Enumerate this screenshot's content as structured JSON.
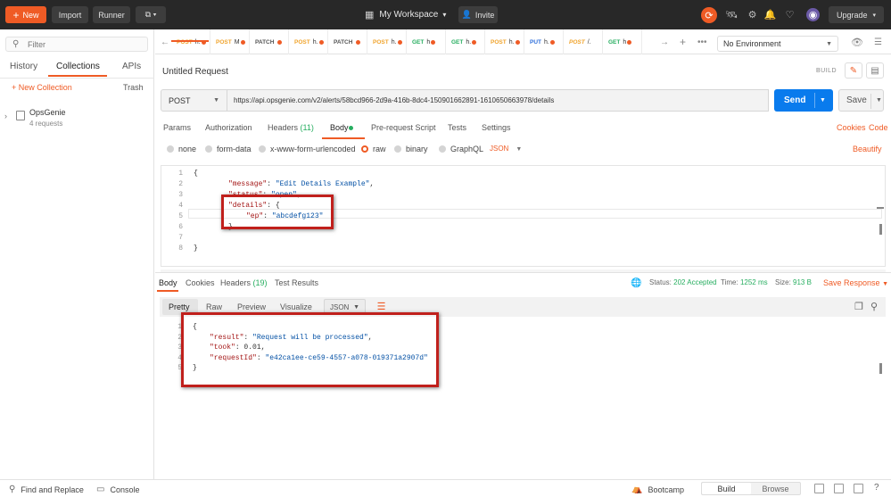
{
  "topbar": {
    "new_label": "New",
    "import_label": "Import",
    "runner_label": "Runner",
    "workspace_label": "My Workspace",
    "invite_label": "Invite",
    "upgrade_label": "Upgrade"
  },
  "sidebar": {
    "search_placeholder": "Filter",
    "tabs": [
      "History",
      "Collections",
      "APIs"
    ],
    "new_collection_label": "+ New Collection",
    "trash_label": "Trash",
    "collection": {
      "name": "OpsGenie",
      "count": "4 requests"
    }
  },
  "tabs": [
    {
      "method": "POST",
      "name": "h."
    },
    {
      "method": "POST",
      "name": "M"
    },
    {
      "method": "PATCH",
      "name": ""
    },
    {
      "method": "POST",
      "name": "h."
    },
    {
      "method": "PATCH",
      "name": ""
    },
    {
      "method": "POST",
      "name": "h."
    },
    {
      "method": "GET",
      "name": "h"
    },
    {
      "method": "GET",
      "name": "h."
    },
    {
      "method": "POST",
      "name": "h."
    },
    {
      "method": "PUT",
      "name": "h."
    },
    {
      "method": "POST",
      "name": "/."
    },
    {
      "method": "GET",
      "name": "h"
    }
  ],
  "environment": "No Environment",
  "request": {
    "title": "Untitled Request",
    "build_label": "BUILD",
    "method": "POST",
    "url": "https://api.opsgenie.com/v2/alerts/58bcd966-2d9a-416b-8dc4-150901662891-1610650663978/details",
    "send_label": "Send",
    "save_label": "Save"
  },
  "request_tabs": {
    "params": "Params",
    "authorization": "Authorization",
    "headers": "Headers",
    "headers_count": "(11)",
    "body": "Body",
    "pre_request": "Pre-request Script",
    "tests": "Tests",
    "settings": "Settings",
    "cookies": "Cookies",
    "code": "Code"
  },
  "body_modes": {
    "none": "none",
    "form_data": "form-data",
    "urlencoded": "x-www-form-urlencoded",
    "raw": "raw",
    "binary": "binary",
    "graphql": "GraphQL",
    "format": "JSON",
    "beautify": "Beautify"
  },
  "editor": {
    "line_numbers": [
      "1",
      "2",
      "3",
      "4",
      "5",
      "6",
      "7",
      "8"
    ],
    "open_brace": "{",
    "close_brace": "}",
    "inner_open": "{",
    "inner_close": "}",
    "k_message": "\"message\"",
    "v_message": "\"Edit Details Example\"",
    "k_status": "\"status\"",
    "v_status": "\"open\"",
    "k_details": "\"details\"",
    "k_ep": "\"ep\"",
    "v_ep": "\"abcdefg123\""
  },
  "response_tabs": {
    "body": "Body",
    "cookies": "Cookies",
    "headers": "Headers",
    "headers_count": "(19)",
    "test_results": "Test Results"
  },
  "response_status": {
    "status_label": "Status:",
    "status_value": "202 Accepted",
    "time_label": "Time:",
    "time_value": "1252 ms",
    "size_label": "Size:",
    "size_value": "913 B",
    "save_response": "Save Response"
  },
  "response_views": {
    "pretty": "Pretty",
    "raw": "Raw",
    "preview": "Preview",
    "visualize": "Visualize",
    "format": "JSON"
  },
  "response_body": {
    "line_numbers": [
      "1",
      "2",
      "3",
      "4",
      "5"
    ],
    "open_brace": "{",
    "close_brace": "}",
    "k_result": "\"result\"",
    "v_result": "\"Request will be processed\"",
    "k_took": "\"took\"",
    "v_took": "0.01",
    "k_request_id": "\"requestId\"",
    "v_request_id": "\"e42ca1ee-ce59-4557-a078-019371a2907d\""
  },
  "bottombar": {
    "find_replace": "Find and Replace",
    "console": "Console",
    "bootcamp": "Bootcamp",
    "build": "Build",
    "browse": "Browse"
  },
  "colors": {
    "accent": "#ef5b25",
    "send_blue": "#097bed",
    "status_green": "#27ae60",
    "annotation_red": "#c0201c"
  }
}
